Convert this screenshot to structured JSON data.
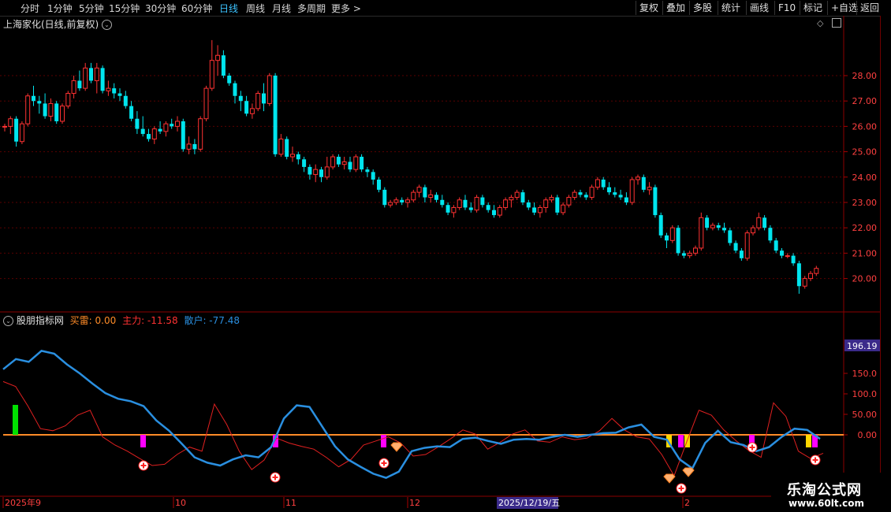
{
  "toolbar": {
    "periods": [
      "分时",
      "1分钟",
      "5分钟",
      "15分钟",
      "30分钟",
      "60分钟",
      "日线",
      "周线",
      "月线",
      "多周期",
      "更多 >"
    ],
    "active_period": "日线",
    "right_buttons": [
      "复权",
      "叠加",
      "多股",
      "统计",
      "画线",
      "F10",
      "标记",
      "+自选",
      "返回"
    ]
  },
  "main_chart": {
    "title": "上海家化(日线,前复权)",
    "price_ticks": [
      "28.00",
      "27.00",
      "26.00",
      "25.00",
      "24.00",
      "23.00",
      "22.00",
      "21.00",
      "20.00"
    ]
  },
  "indicator": {
    "name": "股朋指标网",
    "buy_label": "买雷: 0.00",
    "main_label": "主力: -11.58",
    "retail_label": "散户: -77.48",
    "current_value": "196.19",
    "ticks": [
      "150.0",
      "100.0",
      "50.00",
      "0.00"
    ]
  },
  "date_axis": {
    "labels": [
      "2025年9",
      "10",
      "11",
      "12",
      "2"
    ],
    "highlight": "2025/12/19/五"
  },
  "watermark": {
    "main": "乐淘公式网",
    "url": "www.60lt.com"
  },
  "colors": {
    "up": "#ff3232",
    "down": "#00e5ee",
    "zero_line": "#ff8c28",
    "main_line": "#2a8fe0",
    "retail_line": "#e02020",
    "magenta": "#ff00ff",
    "yellow": "#ffd700",
    "green": "#00e000"
  },
  "chart_data": {
    "type": "candlestick",
    "ohlc": [
      [
        26.0,
        26.1,
        25.8,
        26.0
      ],
      [
        26.0,
        26.4,
        25.7,
        26.3
      ],
      [
        26.3,
        26.4,
        25.2,
        25.4
      ],
      [
        25.4,
        26.2,
        25.3,
        26.1
      ],
      [
        26.1,
        27.3,
        26.0,
        27.2
      ],
      [
        27.2,
        27.6,
        26.8,
        27.0
      ],
      [
        27.0,
        27.2,
        26.5,
        26.9
      ],
      [
        26.9,
        27.3,
        26.3,
        26.4
      ],
      [
        26.4,
        27.1,
        26.2,
        26.9
      ],
      [
        26.9,
        27.0,
        26.1,
        26.2
      ],
      [
        26.2,
        26.9,
        26.1,
        26.8
      ],
      [
        26.8,
        27.4,
        26.7,
        27.3
      ],
      [
        27.3,
        28.0,
        27.1,
        27.8
      ],
      [
        27.8,
        28.2,
        27.4,
        27.5
      ],
      [
        27.5,
        28.5,
        27.4,
        28.3
      ],
      [
        28.3,
        28.5,
        27.7,
        27.8
      ],
      [
        27.8,
        28.5,
        27.3,
        28.3
      ],
      [
        28.3,
        28.4,
        27.3,
        27.4
      ],
      [
        27.4,
        27.8,
        27.2,
        27.5
      ],
      [
        27.5,
        27.7,
        27.1,
        27.3
      ],
      [
        27.3,
        27.5,
        27.0,
        27.2
      ],
      [
        27.2,
        27.4,
        26.7,
        26.8
      ],
      [
        26.8,
        27.0,
        26.2,
        26.3
      ],
      [
        26.3,
        26.6,
        25.7,
        25.9
      ],
      [
        25.9,
        26.4,
        25.6,
        25.7
      ],
      [
        25.7,
        25.9,
        25.4,
        25.5
      ],
      [
        25.5,
        26.0,
        25.3,
        25.9
      ],
      [
        25.9,
        26.2,
        25.7,
        25.8
      ],
      [
        25.8,
        26.2,
        25.6,
        26.1
      ],
      [
        26.1,
        26.3,
        25.9,
        26.0
      ],
      [
        26.0,
        26.4,
        25.8,
        26.2
      ],
      [
        26.2,
        26.3,
        25.0,
        25.1
      ],
      [
        25.1,
        25.6,
        24.9,
        25.3
      ],
      [
        25.3,
        25.5,
        24.9,
        25.1
      ],
      [
        25.1,
        26.4,
        25.0,
        26.3
      ],
      [
        26.3,
        27.6,
        26.2,
        27.5
      ],
      [
        27.5,
        29.4,
        27.4,
        28.6
      ],
      [
        28.6,
        29.2,
        28.0,
        28.8
      ],
      [
        28.8,
        29.0,
        27.9,
        28.0
      ],
      [
        28.0,
        28.1,
        27.6,
        27.7
      ],
      [
        27.7,
        27.8,
        26.9,
        27.2
      ],
      [
        27.2,
        27.4,
        26.6,
        27.0
      ],
      [
        27.0,
        27.2,
        26.4,
        26.5
      ],
      [
        26.5,
        26.9,
        26.3,
        26.7
      ],
      [
        26.7,
        27.4,
        26.6,
        27.3
      ],
      [
        27.3,
        27.7,
        26.6,
        26.9
      ],
      [
        26.9,
        28.1,
        26.8,
        28.0
      ],
      [
        28.0,
        28.1,
        24.8,
        24.9
      ],
      [
        24.9,
        25.7,
        24.8,
        25.5
      ],
      [
        25.5,
        25.6,
        24.7,
        24.8
      ],
      [
        24.8,
        25.2,
        24.6,
        24.9
      ],
      [
        24.9,
        25.0,
        24.5,
        24.7
      ],
      [
        24.7,
        24.8,
        24.2,
        24.4
      ],
      [
        24.4,
        24.5,
        23.9,
        24.1
      ],
      [
        24.1,
        24.5,
        23.8,
        24.3
      ],
      [
        24.3,
        24.4,
        23.8,
        24.0
      ],
      [
        24.0,
        24.8,
        23.9,
        24.4
      ],
      [
        24.4,
        24.9,
        24.3,
        24.8
      ],
      [
        24.8,
        24.9,
        24.4,
        24.5
      ],
      [
        24.5,
        24.8,
        24.3,
        24.6
      ],
      [
        24.6,
        24.8,
        24.2,
        24.3
      ],
      [
        24.3,
        24.9,
        24.2,
        24.8
      ],
      [
        24.8,
        24.9,
        24.2,
        24.3
      ],
      [
        24.3,
        24.4,
        24.0,
        24.2
      ],
      [
        24.2,
        24.3,
        23.7,
        23.9
      ],
      [
        23.9,
        24.0,
        23.4,
        23.5
      ],
      [
        23.5,
        23.6,
        22.8,
        22.9
      ],
      [
        22.9,
        23.1,
        22.8,
        23.0
      ],
      [
        23.0,
        23.2,
        22.9,
        23.1
      ],
      [
        23.1,
        23.2,
        22.9,
        23.0
      ],
      [
        23.0,
        23.2,
        22.8,
        23.1
      ],
      [
        23.1,
        23.5,
        23.0,
        23.4
      ],
      [
        23.4,
        23.7,
        23.2,
        23.6
      ],
      [
        23.6,
        23.7,
        23.0,
        23.2
      ],
      [
        23.2,
        23.5,
        23.0,
        23.3
      ],
      [
        23.3,
        23.4,
        23.0,
        23.1
      ],
      [
        23.1,
        23.3,
        22.8,
        22.9
      ],
      [
        22.9,
        23.0,
        22.5,
        22.6
      ],
      [
        22.6,
        22.9,
        22.4,
        22.8
      ],
      [
        22.8,
        23.2,
        22.7,
        23.1
      ],
      [
        23.1,
        23.3,
        22.7,
        22.8
      ],
      [
        22.8,
        23.0,
        22.6,
        22.7
      ],
      [
        22.7,
        23.3,
        22.6,
        23.2
      ],
      [
        23.2,
        23.3,
        22.8,
        22.9
      ],
      [
        22.9,
        23.0,
        22.6,
        22.7
      ],
      [
        22.7,
        22.9,
        22.4,
        22.5
      ],
      [
        22.5,
        22.9,
        22.4,
        22.8
      ],
      [
        22.8,
        23.2,
        22.7,
        23.1
      ],
      [
        23.1,
        23.3,
        22.8,
        23.2
      ],
      [
        23.2,
        23.5,
        23.1,
        23.4
      ],
      [
        23.4,
        23.5,
        22.9,
        23.0
      ],
      [
        23.0,
        23.1,
        22.7,
        22.8
      ],
      [
        22.8,
        23.0,
        22.5,
        22.6
      ],
      [
        22.6,
        22.9,
        22.4,
        22.8
      ],
      [
        22.8,
        23.2,
        22.6,
        23.1
      ],
      [
        23.1,
        23.3,
        23.0,
        23.2
      ],
      [
        23.2,
        23.3,
        22.5,
        22.6
      ],
      [
        22.6,
        23.0,
        22.5,
        22.9
      ],
      [
        22.9,
        23.3,
        22.8,
        23.2
      ],
      [
        23.2,
        23.5,
        23.1,
        23.4
      ],
      [
        23.4,
        23.5,
        23.2,
        23.3
      ],
      [
        23.3,
        23.4,
        23.1,
        23.2
      ],
      [
        23.2,
        23.7,
        23.1,
        23.6
      ],
      [
        23.6,
        24.0,
        23.5,
        23.9
      ],
      [
        23.9,
        24.0,
        23.5,
        23.6
      ],
      [
        23.6,
        23.8,
        23.3,
        23.4
      ],
      [
        23.4,
        23.6,
        23.2,
        23.3
      ],
      [
        23.3,
        23.5,
        23.1,
        23.2
      ],
      [
        23.2,
        23.4,
        22.9,
        23.0
      ],
      [
        23.0,
        24.0,
        22.9,
        23.9
      ],
      [
        23.9,
        24.1,
        23.7,
        24.0
      ],
      [
        24.0,
        24.1,
        23.4,
        23.5
      ],
      [
        23.5,
        23.8,
        23.3,
        23.6
      ],
      [
        23.6,
        23.7,
        22.4,
        22.5
      ],
      [
        22.5,
        22.6,
        21.6,
        21.7
      ],
      [
        21.7,
        21.8,
        21.2,
        21.5
      ],
      [
        21.5,
        22.1,
        21.4,
        22.0
      ],
      [
        22.0,
        22.1,
        20.9,
        21.0
      ],
      [
        21.0,
        21.1,
        20.8,
        20.9
      ],
      [
        20.9,
        21.1,
        20.8,
        21.0
      ],
      [
        21.0,
        21.3,
        20.9,
        21.2
      ],
      [
        21.2,
        22.6,
        21.1,
        22.4
      ],
      [
        22.4,
        22.5,
        21.9,
        22.0
      ],
      [
        22.0,
        22.2,
        21.9,
        22.1
      ],
      [
        22.1,
        22.2,
        21.9,
        22.0
      ],
      [
        22.0,
        22.2,
        21.8,
        21.9
      ],
      [
        21.9,
        22.0,
        21.3,
        21.4
      ],
      [
        21.4,
        21.5,
        21.0,
        21.1
      ],
      [
        21.1,
        21.2,
        20.7,
        20.8
      ],
      [
        20.8,
        21.9,
        20.7,
        21.8
      ],
      [
        21.8,
        22.1,
        21.7,
        22.0
      ],
      [
        22.0,
        22.6,
        21.9,
        22.4
      ],
      [
        22.4,
        22.5,
        21.9,
        22.0
      ],
      [
        22.0,
        22.1,
        21.4,
        21.5
      ],
      [
        21.5,
        21.6,
        21.0,
        21.1
      ],
      [
        21.1,
        21.2,
        20.8,
        20.9
      ],
      [
        20.9,
        21.0,
        20.8,
        20.9
      ],
      [
        20.9,
        21.0,
        20.5,
        20.6
      ],
      [
        20.6,
        20.7,
        19.4,
        19.7
      ],
      [
        19.7,
        20.1,
        19.6,
        20.0
      ],
      [
        20.0,
        20.3,
        19.9,
        20.2
      ],
      [
        20.2,
        20.5,
        20.1,
        20.4
      ]
    ],
    "indicator": {
      "main": [
        160,
        185,
        178,
        205,
        198,
        172,
        150,
        125,
        102,
        88,
        82,
        70,
        35,
        10,
        -22,
        -55,
        -68,
        -75,
        -60,
        -50,
        -55,
        -30,
        40,
        72,
        68,
        20,
        -28,
        -60,
        -78,
        -95,
        -105,
        -90,
        -40,
        -32,
        -28,
        -30,
        -10,
        -7,
        -15,
        -22,
        -12,
        -10,
        -12,
        -5,
        0,
        -5,
        0,
        4,
        5,
        18,
        25,
        -5,
        -12,
        -60,
        -82,
        -20,
        10,
        -18,
        -25,
        -40,
        -30,
        -5,
        15,
        12,
        -10
      ],
      "retail": [
        130,
        118,
        70,
        15,
        10,
        22,
        48,
        60,
        -5,
        -25,
        -40,
        -58,
        -75,
        -72,
        -48,
        -30,
        -40,
        75,
        25,
        -40,
        -85,
        -62,
        -8,
        -20,
        -28,
        -35,
        -55,
        -78,
        -60,
        -25,
        -15,
        -5,
        -20,
        -52,
        -48,
        -30,
        -10,
        12,
        2,
        -35,
        -18,
        2,
        12,
        -15,
        -18,
        -5,
        -12,
        -8,
        10,
        40,
        12,
        -5,
        -10,
        -48,
        -100,
        -18,
        60,
        48,
        12,
        -15,
        -38,
        -55,
        78,
        45,
        -40,
        -58,
        -45
      ]
    }
  }
}
